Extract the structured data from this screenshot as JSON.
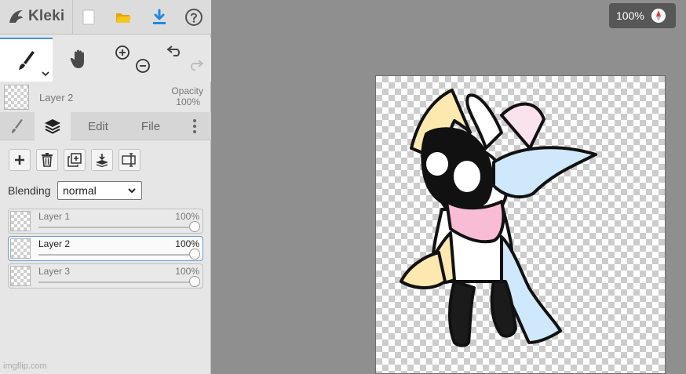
{
  "app": {
    "logo_text": "Kleki"
  },
  "toolbar_icons": [
    "kleki-logo-icon",
    "new-file-icon",
    "open-folder-icon",
    "download-icon",
    "help-icon"
  ],
  "tools": {
    "brush_icon": "brush-icon",
    "hand_icon": "hand-icon",
    "zoom_in_icon": "zoom-in-icon",
    "zoom_out_icon": "zoom-out-icon",
    "undo_icon": "undo-icon",
    "redo_icon": "redo-icon"
  },
  "current_layer": {
    "name": "Layer 2",
    "opacity_label": "Opacity",
    "opacity_value": "100%"
  },
  "tabs": [
    {
      "icon": "brush-icon",
      "label": ""
    },
    {
      "icon": "layers-icon",
      "label": ""
    },
    {
      "icon": "",
      "label": "Edit"
    },
    {
      "icon": "",
      "label": "File"
    },
    {
      "icon": "more-vertical-icon",
      "label": ""
    }
  ],
  "layer_actions": [
    "add-layer-icon",
    "delete-layer-icon",
    "duplicate-layer-icon",
    "merge-down-icon",
    "rename-layer-icon"
  ],
  "blending": {
    "label": "Blending",
    "value": "normal"
  },
  "layers": [
    {
      "name": "Layer 1",
      "opacity": "100%",
      "opacity_fraction": 1.0,
      "selected": false
    },
    {
      "name": "Layer 2",
      "opacity": "100%",
      "opacity_fraction": 1.0,
      "selected": true
    },
    {
      "name": "Layer 3",
      "opacity": "100%",
      "opacity_fraction": 1.0,
      "selected": false
    }
  ],
  "zoom": {
    "value": "100%"
  },
  "watermark": "imgflip.com",
  "colors": {
    "accent": "#4a90d9",
    "download": "#1e88e5",
    "folder": "#f5c518",
    "pink": "#f8bcd4",
    "blue": "#cfe8fb",
    "yellow": "#fde9b0"
  }
}
